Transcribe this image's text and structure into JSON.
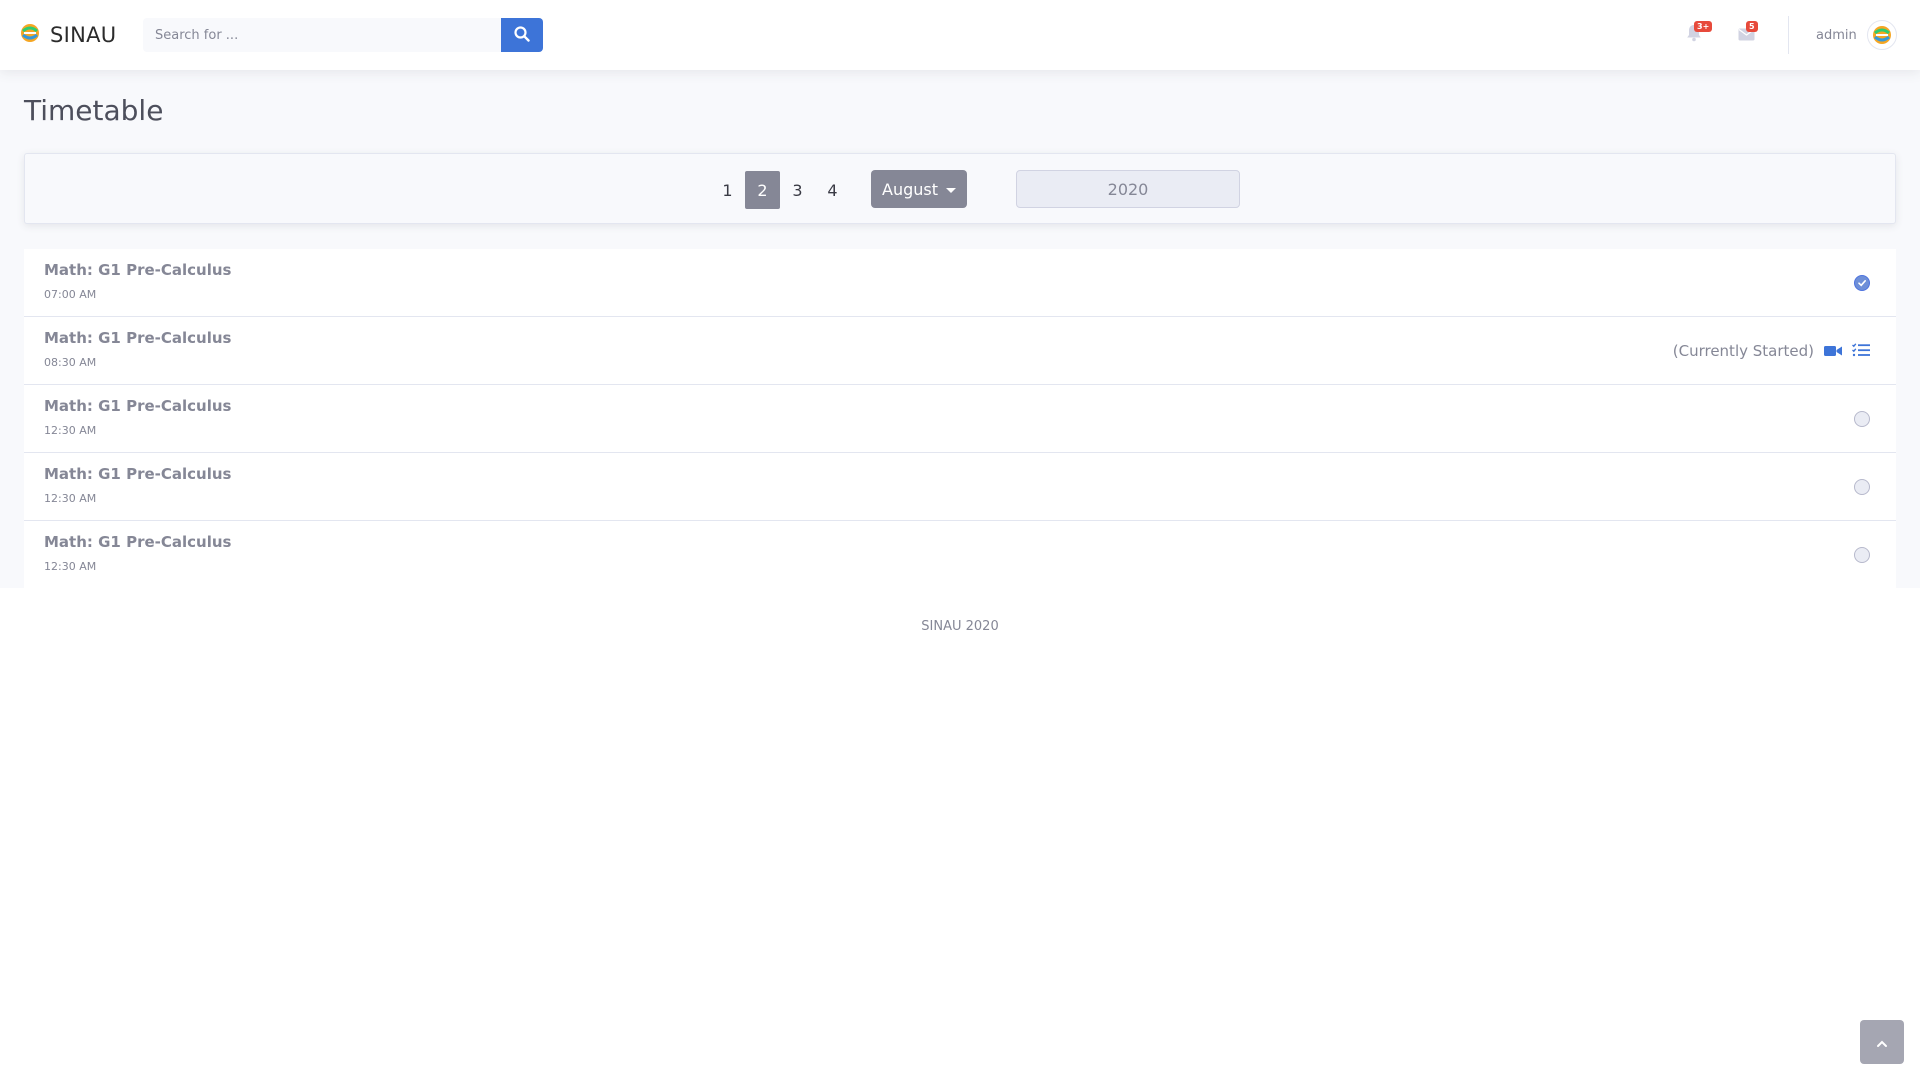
{
  "brand": {
    "name": "SINAU"
  },
  "search": {
    "placeholder": "Search for ..."
  },
  "header": {
    "alerts_badge": "3+",
    "messages_badge": "5",
    "user_name": "admin"
  },
  "page": {
    "title": "Timetable"
  },
  "filters": {
    "weeks": [
      "1",
      "2",
      "3",
      "4"
    ],
    "selected_week": "2",
    "month": "August",
    "year": "2020"
  },
  "schedule": [
    {
      "title": "Math: G1 Pre-Calculus",
      "time": "07:00 AM",
      "status": "done"
    },
    {
      "title": "Math: G1 Pre-Calculus",
      "time": "08:30 AM",
      "status": "started",
      "status_text": "(Currently Started)"
    },
    {
      "title": "Math: G1 Pre-Calculus",
      "time": "12:30 AM",
      "status": "pending"
    },
    {
      "title": "Math: G1 Pre-Calculus",
      "time": "12:30 AM",
      "status": "pending"
    },
    {
      "title": "Math: G1 Pre-Calculus",
      "time": "12:30 AM",
      "status": "pending"
    }
  ],
  "footer": {
    "text": "SINAU 2020"
  },
  "colors": {
    "primary": "#3d74d8",
    "secondary": "#858796",
    "danger": "#e74a3b",
    "background": "#f8f9fc"
  },
  "icons": {
    "search_button": "search-icon",
    "alerts": "bell-icon",
    "messages": "envelope-icon",
    "started_video": "video-icon",
    "started_tasks": "list-check-icon",
    "scroll_top": "chevron-up-icon"
  }
}
